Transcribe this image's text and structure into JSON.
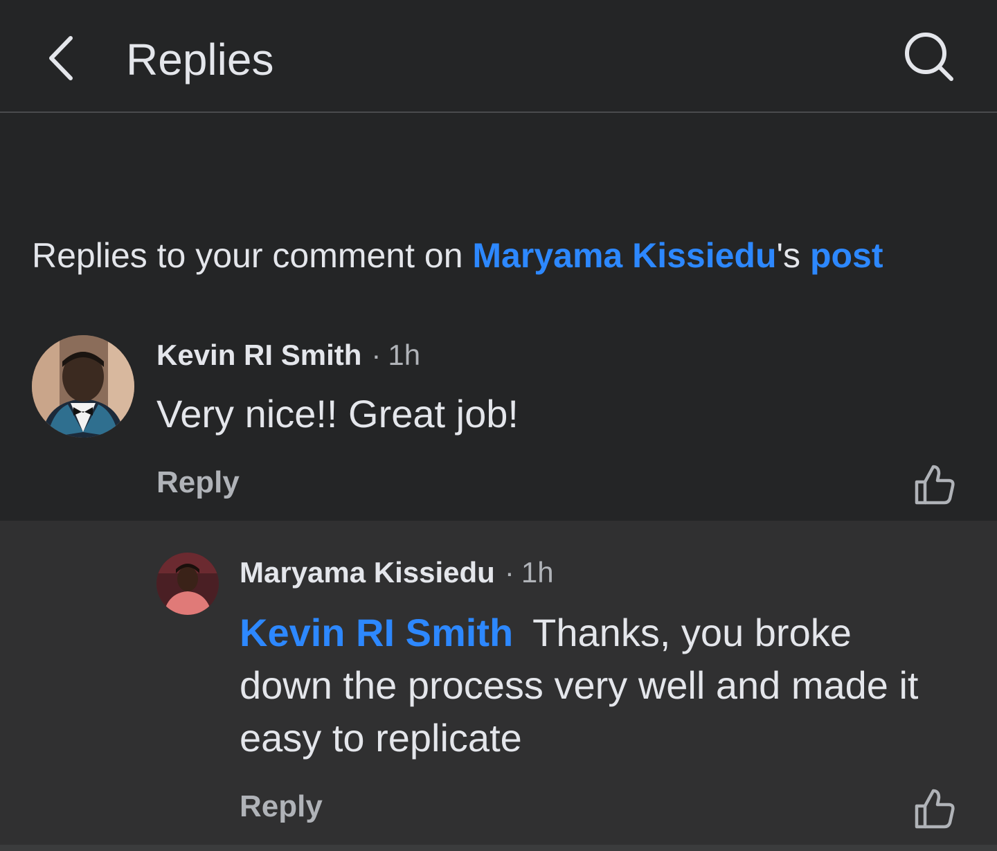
{
  "header": {
    "title": "Replies",
    "back_icon": "chevron-left-icon",
    "search_icon": "search-icon"
  },
  "context": {
    "prefix": "Replies to your comment on ",
    "post_author": "Maryama Kissiedu",
    "possessive": "'s ",
    "post_link": "post"
  },
  "comments": [
    {
      "author": "Kevin RI Smith",
      "time": "1h",
      "text": "Very nice!! Great job!",
      "reply_label": "Reply",
      "like_icon": "thumbs-up-icon"
    },
    {
      "author": "Maryama Kissiedu",
      "time": "1h",
      "mention": "Kevin RI Smith",
      "text": "Thanks, you broke down the process very well and made it easy to replicate",
      "reply_label": "Reply",
      "like_icon": "thumbs-up-icon"
    }
  ],
  "colors": {
    "background": "#242526",
    "nested_background": "#303031",
    "text_primary": "#e4e6eb",
    "text_secondary": "#b0b3b8",
    "link_blue": "#2d88ff"
  }
}
